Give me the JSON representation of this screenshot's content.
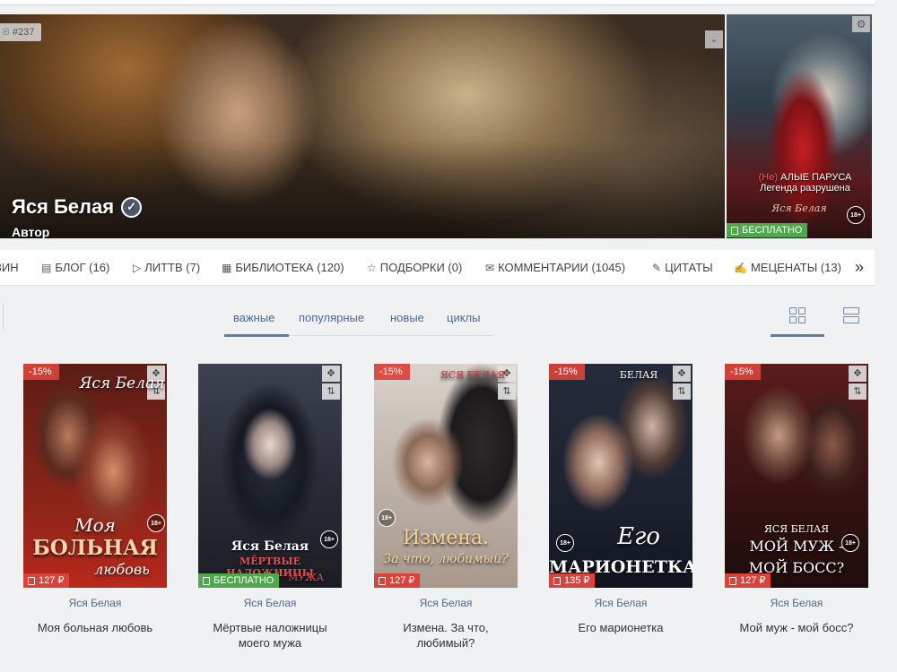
{
  "banner": {
    "badge": "#237",
    "author_name": "Яся Белая",
    "author_role": "Автор",
    "collapse_icon": "chevron-double-down-icon"
  },
  "featured_book": {
    "title_line1_red": "(Не)",
    "title_line1": "АЛЫЕ ПАРУСА",
    "title_line2": "Легенда разрушена",
    "cover_author": "Яся Белая",
    "age": "18+",
    "price_label": "БЕСПЛАТНО"
  },
  "tabs": [
    {
      "label": "ЗИН",
      "icon": "none"
    },
    {
      "label": "БЛОГ (16)",
      "icon": "blog-icon"
    },
    {
      "label": "ЛИТТВ (7)",
      "icon": "video-icon"
    },
    {
      "label": "БИБЛИОТЕКА (120)",
      "icon": "library-icon"
    },
    {
      "label": "ПОДБОРКИ (0)",
      "icon": "star-icon"
    },
    {
      "label": "КОММЕНТАРИИ (1045)",
      "icon": "comments-icon"
    },
    {
      "label": "ЦИТАТЫ",
      "icon": "pen-icon"
    },
    {
      "label": "МЕЦЕНАТЫ (13)",
      "icon": "hand-icon"
    }
  ],
  "tabs_more": "»",
  "filters": [
    "важные",
    "популярные",
    "новые",
    "циклы"
  ],
  "active_filter": "важные",
  "books": [
    {
      "discount": "-15%",
      "price": "127 ₽",
      "price_type": "paid",
      "age": "18+",
      "author": "Яся Белая",
      "title": "Моя больная любовь",
      "cover_author": "Яся Белая",
      "cover_line1": "Моя",
      "cover_line2": "БОЛЬНАЯ",
      "cover_line3": "любовь"
    },
    {
      "discount": "",
      "price": "БЕСПЛАТНО",
      "price_type": "free",
      "age": "18+",
      "author": "Яся Белая",
      "title": "Мёртвые наложницы моего мужа",
      "cover_author": "Яся Белая",
      "cover_line1": "МЁРТВЫЕ НАЛОЖНИЦЫ",
      "cover_line2": "МУЖА",
      "cover_line3": ""
    },
    {
      "discount": "-15%",
      "price": "127 ₽",
      "price_type": "paid",
      "age": "18+",
      "author": "Яся Белая",
      "title": "Измена. За что, любимый?",
      "cover_author": "ЯСЯ БЕЛАЯ",
      "cover_line1": "Измена.",
      "cover_line2": "За что, любимый?",
      "cover_line3": ""
    },
    {
      "discount": "-15%",
      "price": "135 ₽",
      "price_type": "paid",
      "age": "18+",
      "author": "Яся Белая",
      "title": "Его марионетка",
      "cover_author": "БЕЛАЯ",
      "cover_line1": "Его",
      "cover_line2": "МАРИОНЕТКА",
      "cover_line3": ""
    },
    {
      "discount": "-15%",
      "price": "127 ₽",
      "price_type": "paid",
      "age": "18+",
      "author": "Яся Белая",
      "title": "Мой муж - мой босс?",
      "cover_author": "ЯСЯ БЕЛАЯ",
      "cover_line1": "МОЙ МУЖ -",
      "cover_line2": "МОЙ БОСС?",
      "cover_line3": ""
    }
  ],
  "colors": {
    "accent": "#5f7ea3",
    "discount": "#d9433b",
    "free": "#4fa84b",
    "link": "#4d6b8e"
  }
}
